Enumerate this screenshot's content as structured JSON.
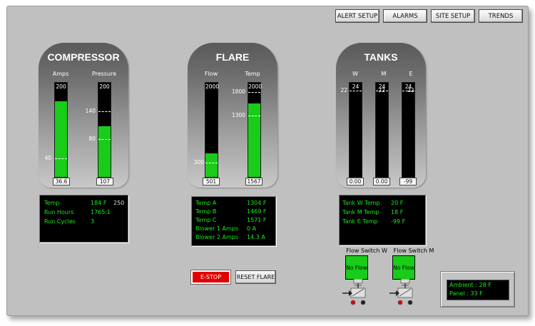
{
  "toolbar": {
    "alert_setup": "ALERT SETUP",
    "alarms": "ALARMS",
    "site_setup": "SITE SETUP",
    "trends": "TRENDS"
  },
  "compressor": {
    "title": "COMPRESSOR",
    "amps": {
      "label": "Amps",
      "max": "200",
      "max_value": 200,
      "setpoint": "40",
      "setpoint_value": 40,
      "fill_value": 160,
      "reading": "36.6"
    },
    "pressure": {
      "label": "Pressure",
      "max": "200",
      "max_value": 200,
      "setpoint_hi": "140",
      "setpoint_hi_value": 140,
      "setpoint_lo": "80",
      "setpoint_lo_value": 80,
      "fill_value": 107,
      "reading": "107"
    },
    "info": {
      "rows": [
        {
          "label": "Temp",
          "value": "184 F",
          "extra": "250"
        },
        {
          "label": "Run Hours",
          "value": "1765:1"
        },
        {
          "label": "Run Cycles",
          "value": "3"
        }
      ]
    }
  },
  "flare": {
    "title": "FLARE",
    "flow": {
      "label": "Flow",
      "max": "2000",
      "max_value": 2000,
      "setpoint": "300",
      "setpoint_value": 300,
      "fill_value": 501,
      "reading": "501"
    },
    "temp": {
      "label": "Temp",
      "max": "2000",
      "max_value": 2000,
      "setpoint_hi": "1800",
      "setpoint_hi_value": 1800,
      "setpoint_lo": "1300",
      "setpoint_lo_value": 1300,
      "fill_value": 1567,
      "reading": "1567"
    },
    "info": {
      "rows": [
        {
          "label": "Temp A",
          "value": "1304 F"
        },
        {
          "label": "Temp B",
          "value": "1469 F"
        },
        {
          "label": "Temp C",
          "value": "1571 F"
        },
        {
          "label": "Blower 1 Amps",
          "value": "0 A"
        },
        {
          "label": "Blower 2 Amps",
          "value": "14.3 A"
        }
      ]
    }
  },
  "tanks": {
    "title": "TANKS",
    "w": {
      "label": "W",
      "max": "24",
      "max_value": 24,
      "setpoint": "22",
      "setpoint_value": 22,
      "fill_value": 0,
      "reading": "0.00"
    },
    "m": {
      "label": "M",
      "max": "24",
      "max_value": 24,
      "setpoint": "22",
      "setpoint_value": 22,
      "fill_value": 0,
      "reading": "0.00"
    },
    "e": {
      "label": "E",
      "max": "24",
      "max_value": 24,
      "setpoint": "22",
      "setpoint_value": 22,
      "fill_value": 0,
      "reading": "-99"
    },
    "info": {
      "rows": [
        {
          "label": "Tank W Temp",
          "value": "20 F"
        },
        {
          "label": "Tank M Temp",
          "value": "18 F"
        },
        {
          "label": "Tank E Temp",
          "value": "-99 F"
        }
      ]
    }
  },
  "actions": {
    "estop": "E-STOP",
    "reset_flare": "RESET FLARE"
  },
  "flow_switches": [
    {
      "label": "Flow Switch W",
      "status": "No Flow"
    },
    {
      "label": "Flow Switch M",
      "status": "No Flow"
    }
  ],
  "ambient": {
    "ambient": "Ambient : 28 F",
    "panel": "Panel : 33 F"
  },
  "colors": {
    "fill_green": "#19cc19",
    "text_green": "#18ee18",
    "estop_red": "#e00000"
  }
}
